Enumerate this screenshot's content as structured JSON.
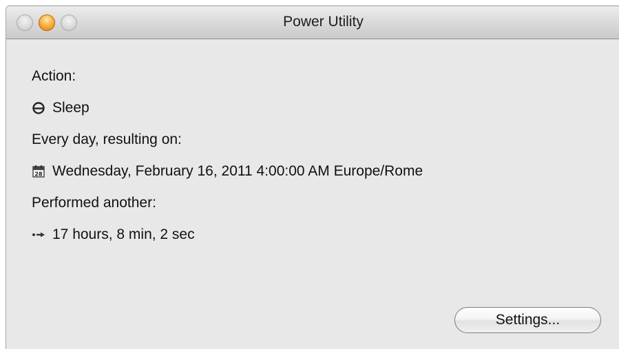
{
  "window": {
    "title": "Power Utility"
  },
  "content": {
    "action_label": "Action:",
    "action_value": "Sleep",
    "schedule_label": "Every day, resulting on:",
    "schedule_value": "Wednesday, February 16, 2011 4:00:00 AM Europe/Rome",
    "remaining_label": "Performed another:",
    "remaining_value": "17 hours, 8 min, 2 sec",
    "calendar_icon_text": "28"
  },
  "buttons": {
    "settings_label": "Settings..."
  },
  "icons": {
    "action": "sleep-icon",
    "schedule": "calendar-icon",
    "remaining": "countdown-arrow-icon"
  },
  "colors": {
    "minimize_button": "#f5a623",
    "window_background": "#e8e8e8"
  }
}
